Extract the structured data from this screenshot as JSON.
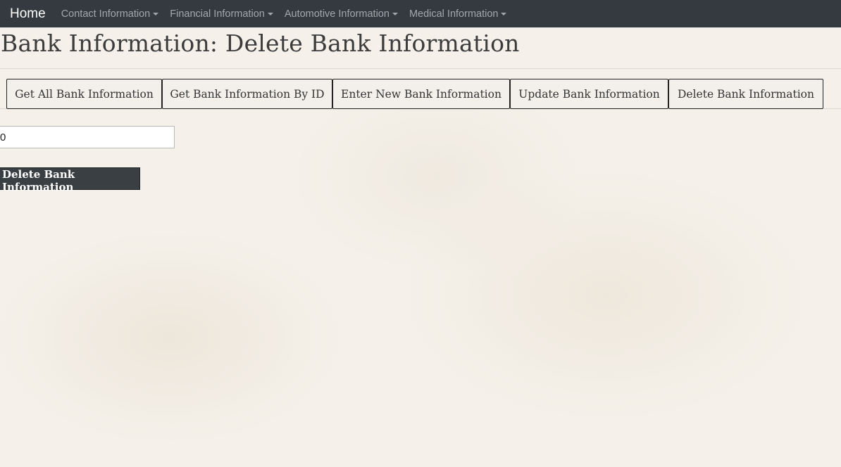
{
  "navbar": {
    "brand": "Home",
    "menus": [
      {
        "label": "Contact Information"
      },
      {
        "label": "Financial Information"
      },
      {
        "label": "Automotive Information"
      },
      {
        "label": "Medical Information"
      }
    ]
  },
  "page": {
    "title": "Bank Information: Delete Bank Information"
  },
  "tabs": [
    {
      "label": "Get All Bank Information"
    },
    {
      "label": "Get Bank Information By ID"
    },
    {
      "label": "Enter New Bank Information"
    },
    {
      "label": "Update Bank Information"
    },
    {
      "label": "Delete Bank Information"
    }
  ],
  "form": {
    "id_value": "0",
    "submit_label": "Delete Bank Information"
  },
  "colors": {
    "navbar_bg": "#343a40",
    "button_bg": "#3a3f44"
  },
  "icons": {
    "dropdown_caret": "caret-down-icon"
  }
}
